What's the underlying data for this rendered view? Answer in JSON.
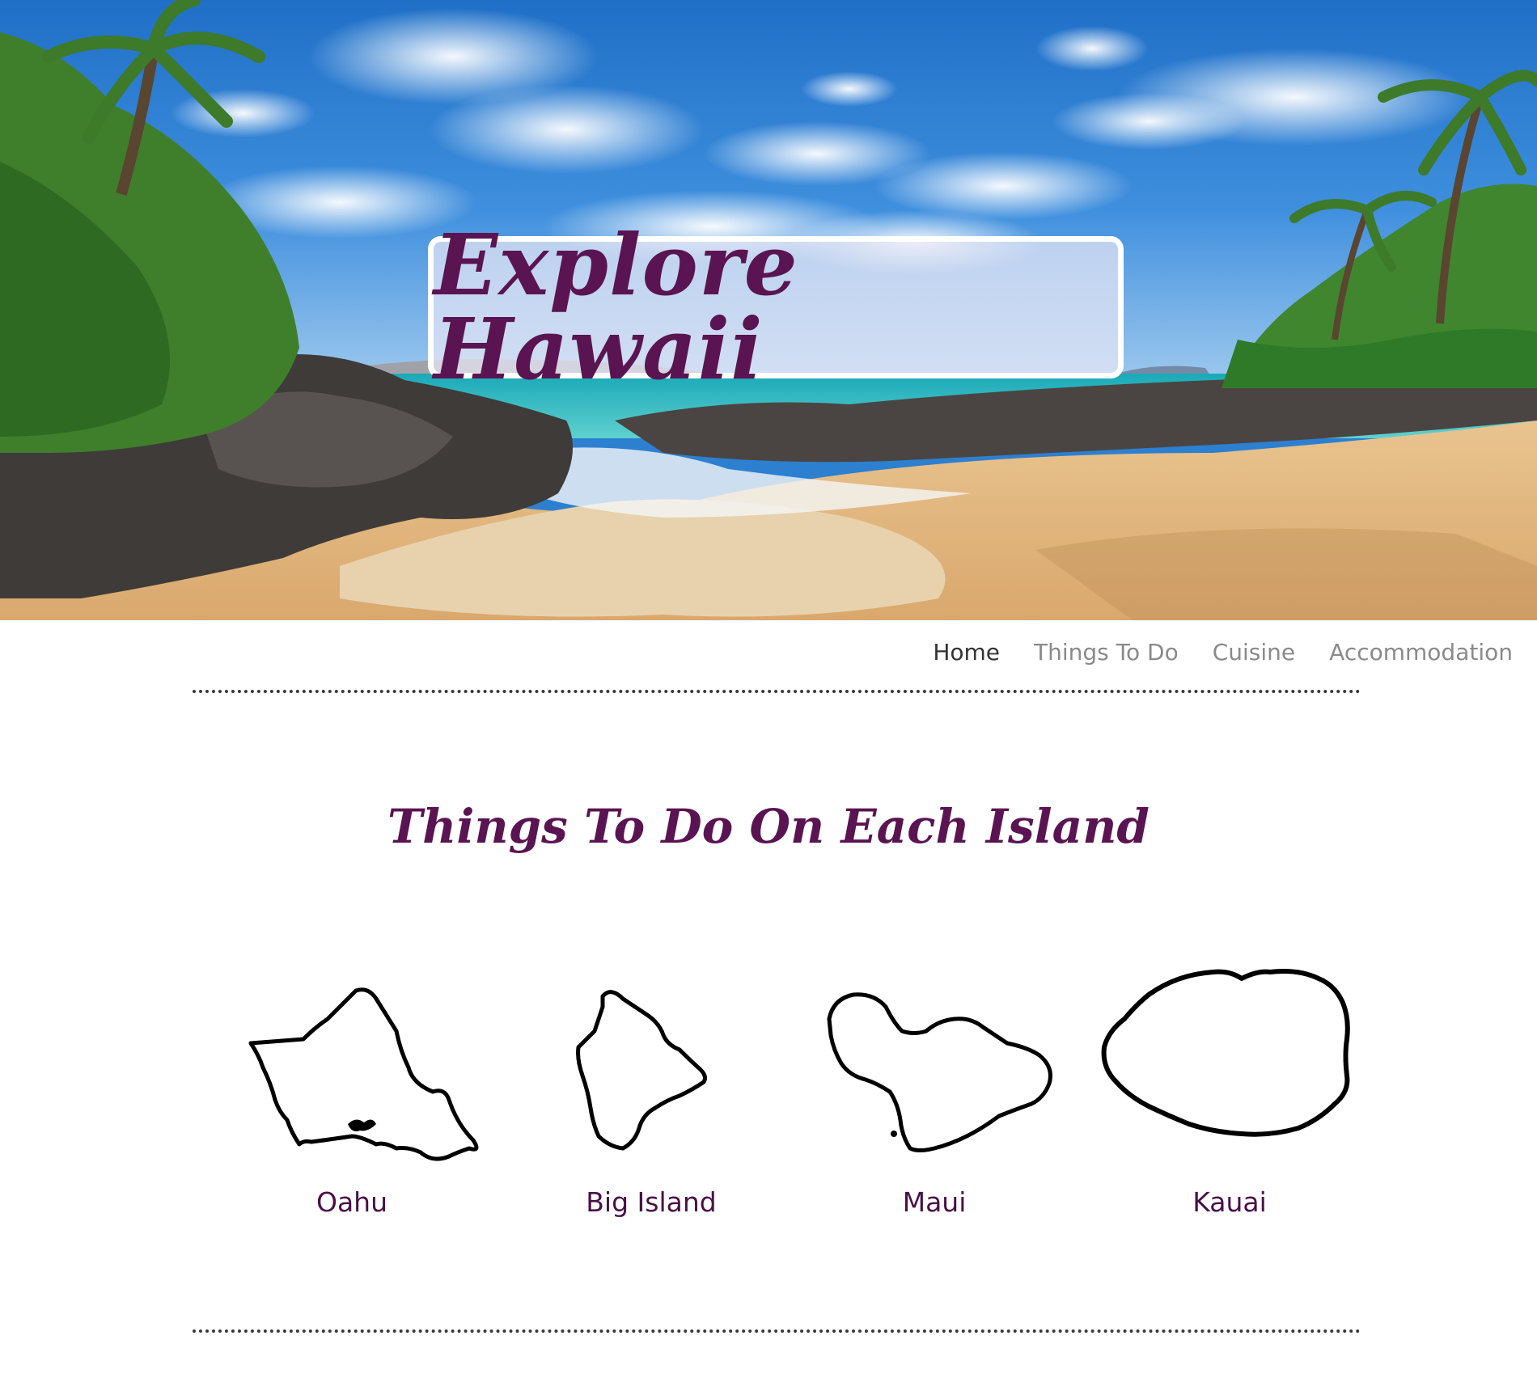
{
  "header": {
    "title": "Explore Hawaii"
  },
  "nav": {
    "items": [
      {
        "label": "Home",
        "active": true
      },
      {
        "label": "Things To Do",
        "active": false
      },
      {
        "label": "Cuisine",
        "active": false
      },
      {
        "label": "Accommodation",
        "active": false
      }
    ]
  },
  "section": {
    "title": "Things To Do On Each Island",
    "islands": [
      {
        "label": "Oahu",
        "icon": "oahu-outline-icon"
      },
      {
        "label": "Big Island",
        "icon": "big-island-outline-icon"
      },
      {
        "label": "Maui",
        "icon": "maui-outline-icon"
      },
      {
        "label": "Kauai",
        "icon": "kauai-outline-icon"
      }
    ]
  },
  "colors": {
    "accent": "#5a1452",
    "nav_active": "#333333",
    "nav_inactive": "#8a8a8a"
  }
}
